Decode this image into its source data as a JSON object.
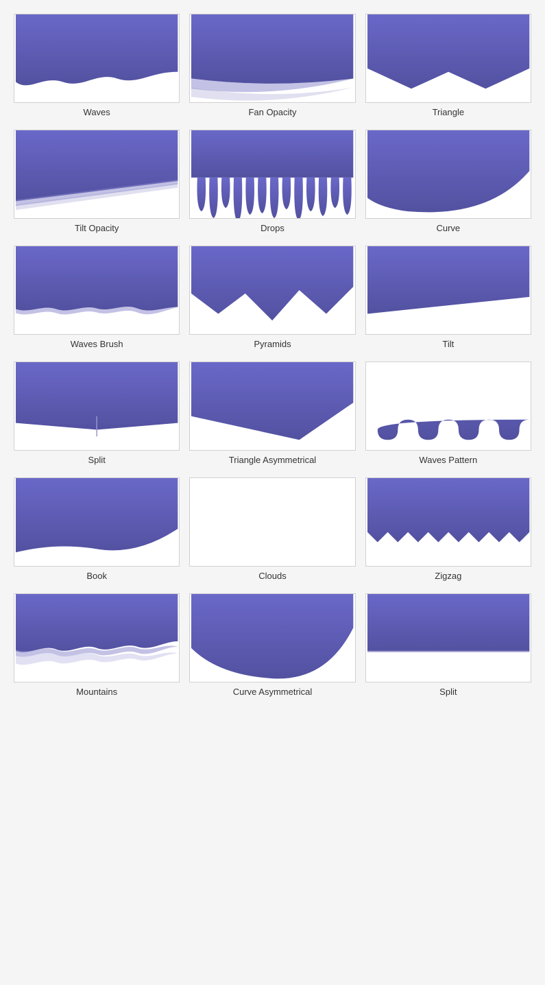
{
  "shapes": [
    {
      "id": "waves",
      "label": "Waves",
      "type": "waves"
    },
    {
      "id": "fan-opacity",
      "label": "Fan Opacity",
      "type": "fan-opacity"
    },
    {
      "id": "triangle",
      "label": "Triangle",
      "type": "triangle"
    },
    {
      "id": "tilt-opacity",
      "label": "Tilt Opacity",
      "type": "tilt-opacity"
    },
    {
      "id": "drops",
      "label": "Drops",
      "type": "drops"
    },
    {
      "id": "curve",
      "label": "Curve",
      "type": "curve"
    },
    {
      "id": "waves-brush",
      "label": "Waves Brush",
      "type": "waves-brush"
    },
    {
      "id": "pyramids",
      "label": "Pyramids",
      "type": "pyramids"
    },
    {
      "id": "tilt",
      "label": "Tilt",
      "type": "tilt"
    },
    {
      "id": "split",
      "label": "Split",
      "type": "split"
    },
    {
      "id": "triangle-asymmetrical",
      "label": "Triangle Asymmetrical",
      "type": "triangle-asymmetrical"
    },
    {
      "id": "waves-pattern",
      "label": "Waves Pattern",
      "type": "waves-pattern"
    },
    {
      "id": "book",
      "label": "Book",
      "type": "book"
    },
    {
      "id": "clouds",
      "label": "Clouds",
      "type": "clouds"
    },
    {
      "id": "zigzag",
      "label": "Zigzag",
      "type": "zigzag"
    },
    {
      "id": "mountains",
      "label": "Mountains",
      "type": "mountains"
    },
    {
      "id": "curve-asymmetrical",
      "label": "Curve Asymmetrical",
      "type": "curve-asymmetrical"
    },
    {
      "id": "split2",
      "label": "Split",
      "type": "split2"
    }
  ],
  "colors": {
    "purple_top": "#5b5aaa",
    "purple_mid": "#6b6ac0",
    "purple_light": "#7b7acc",
    "purple_dark": "#4a4990"
  }
}
